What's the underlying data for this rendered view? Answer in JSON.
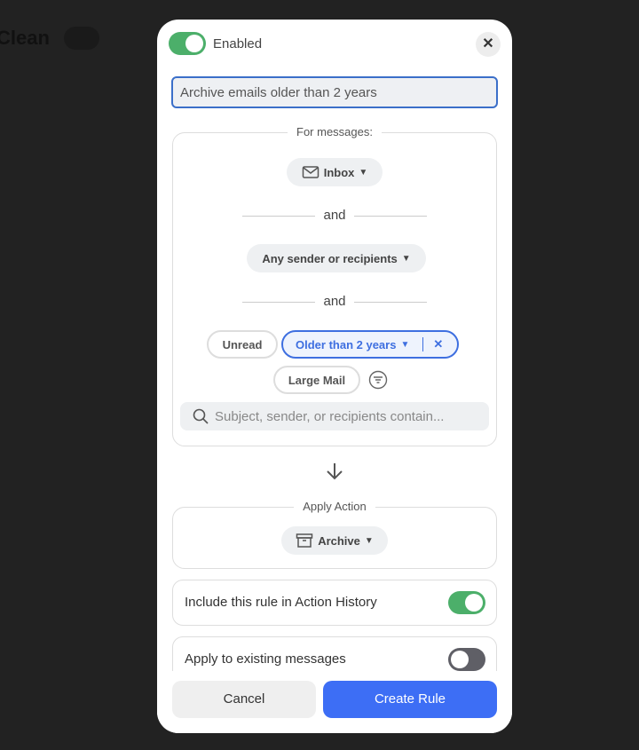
{
  "background": {
    "app_text": "Clean"
  },
  "header": {
    "enabled_label": "Enabled",
    "enabled": true
  },
  "rule_name": {
    "value": "Archive emails older than 2 years"
  },
  "conditions": {
    "legend": "For messages:",
    "mailbox": "Inbox",
    "and1": "and",
    "sender": "Any sender or recipients",
    "and2": "and",
    "filters": [
      {
        "label": "Unread",
        "selected": false
      },
      {
        "label": "Older than 2 years",
        "selected": true
      },
      {
        "label": "Large Mail",
        "selected": false
      }
    ],
    "search_placeholder": "Subject, sender, or recipients contain..."
  },
  "action": {
    "legend": "Apply Action",
    "value": "Archive"
  },
  "options": [
    {
      "label": "Include this rule in Action History",
      "on": true
    },
    {
      "label": "Apply to existing messages",
      "on": false
    }
  ],
  "footer": {
    "cancel": "Cancel",
    "create": "Create Rule"
  },
  "colors": {
    "accent": "#3e6fe0",
    "toggle_on": "#4caf6a",
    "primary_button": "#3d6ef5"
  }
}
